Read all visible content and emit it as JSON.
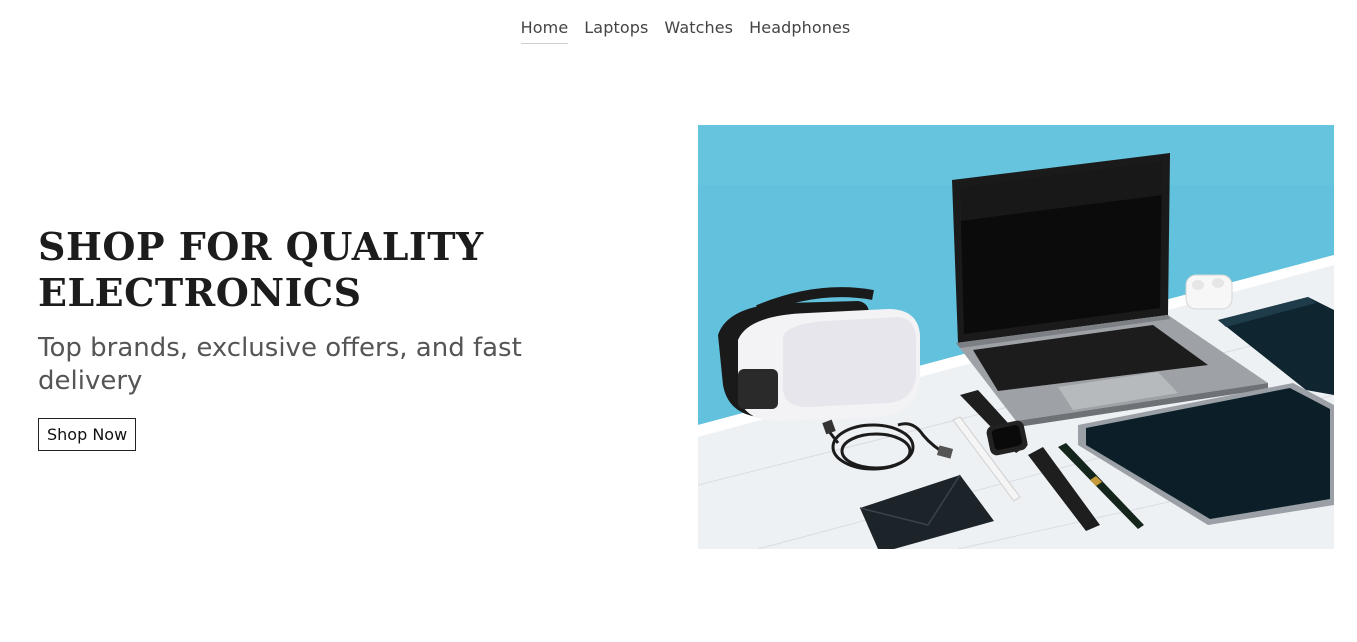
{
  "nav": {
    "items": [
      {
        "label": "Home",
        "active": true
      },
      {
        "label": "Laptops",
        "active": false
      },
      {
        "label": "Watches",
        "active": false
      },
      {
        "label": "Headphones",
        "active": false
      }
    ]
  },
  "hero": {
    "title_line1": "SHOP FOR QUALITY",
    "title_line2": "ELECTRONICS",
    "subtitle": "Top brands, exclusive offers, and fast delivery",
    "cta_label": "Shop Now"
  },
  "colors": {
    "wall": "#62c1dc",
    "desk": "#f0f2f4",
    "text": "#1c1c1c",
    "subtext": "#555555"
  }
}
